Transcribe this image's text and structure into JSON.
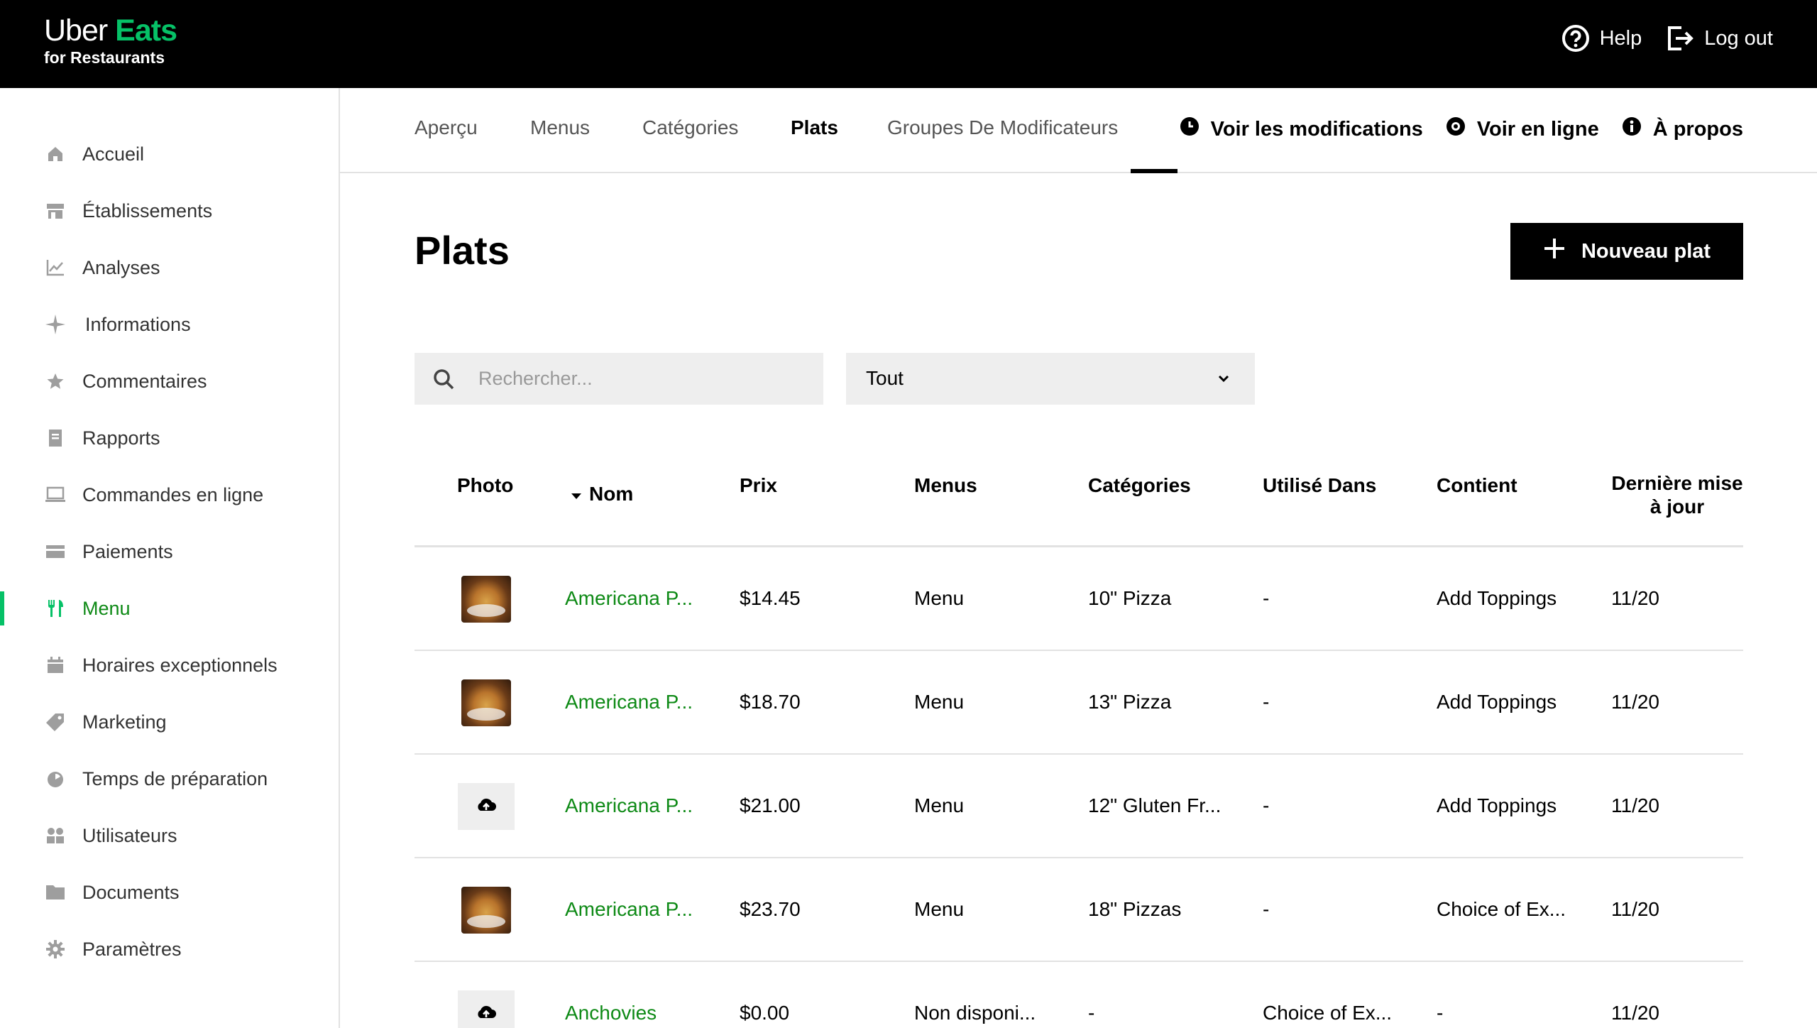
{
  "brand": {
    "line1_a": "Uber",
    "line1_b": "Eats",
    "line2": "for Restaurants",
    "accent": "#06C167"
  },
  "topbar": {
    "help": "Help",
    "logout": "Log out"
  },
  "sidebar": {
    "items": [
      {
        "label": "Accueil",
        "icon": "home-icon"
      },
      {
        "label": "Établissements",
        "icon": "store-icon"
      },
      {
        "label": "Analyses",
        "icon": "chart-icon"
      },
      {
        "label": "Informations",
        "icon": "sparkle-icon"
      },
      {
        "label": "Commentaires",
        "icon": "star-icon"
      },
      {
        "label": "Rapports",
        "icon": "report-icon"
      },
      {
        "label": "Commandes en ligne",
        "icon": "laptop-icon"
      },
      {
        "label": "Paiements",
        "icon": "card-icon"
      },
      {
        "label": "Menu",
        "icon": "utensils-icon",
        "active": true
      },
      {
        "label": "Horaires exceptionnels",
        "icon": "calendar-icon"
      },
      {
        "label": "Marketing",
        "icon": "tag-icon"
      },
      {
        "label": "Temps de préparation",
        "icon": "timer-icon"
      },
      {
        "label": "Utilisateurs",
        "icon": "users-icon"
      },
      {
        "label": "Documents",
        "icon": "folder-icon"
      },
      {
        "label": "Paramètres",
        "icon": "gear-icon"
      }
    ]
  },
  "tabs": {
    "items": [
      "Aperçu",
      "Menus",
      "Catégories",
      "Plats",
      "Groupes De Modificateurs"
    ],
    "active": "Plats",
    "view_changes": "Voir les modifications",
    "view_online": "Voir en ligne",
    "about": "À propos"
  },
  "main": {
    "title": "Plats",
    "new_button": "Nouveau plat",
    "search_placeholder": "Rechercher...",
    "filter_value": "Tout"
  },
  "table": {
    "headers": {
      "photo": "Photo",
      "name": "Nom",
      "price": "Prix",
      "menus": "Menus",
      "categories": "Catégories",
      "used_in": "Utilisé Dans",
      "contains": "Contient",
      "updated_line1": "Dernière mise",
      "updated_line2": "à jour"
    },
    "rows": [
      {
        "photo": "image",
        "name": "Americana P...",
        "price": "$14.45",
        "menus": "Menu",
        "categories": "10\" Pizza",
        "used_in": "-",
        "contains": "Add Toppings",
        "updated": "11/20"
      },
      {
        "photo": "image",
        "name": "Americana P...",
        "price": "$18.70",
        "menus": "Menu",
        "categories": "13\" Pizza",
        "used_in": "-",
        "contains": "Add Toppings",
        "updated": "11/20"
      },
      {
        "photo": "upload",
        "name": "Americana P...",
        "price": "$21.00",
        "menus": "Menu",
        "categories": "12\" Gluten Fr...",
        "used_in": "-",
        "contains": "Add Toppings",
        "updated": "11/20"
      },
      {
        "photo": "image",
        "name": "Americana P...",
        "price": "$23.70",
        "menus": "Menu",
        "categories": "18\" Pizzas",
        "used_in": "-",
        "contains": "Choice of Ex...",
        "updated": "11/20"
      },
      {
        "photo": "upload",
        "name": "Anchovies",
        "price": "$0.00",
        "menus": "Non disponi...",
        "categories": "-",
        "used_in": "Choice of Ex...",
        "contains": "-",
        "updated": "11/20"
      }
    ]
  }
}
